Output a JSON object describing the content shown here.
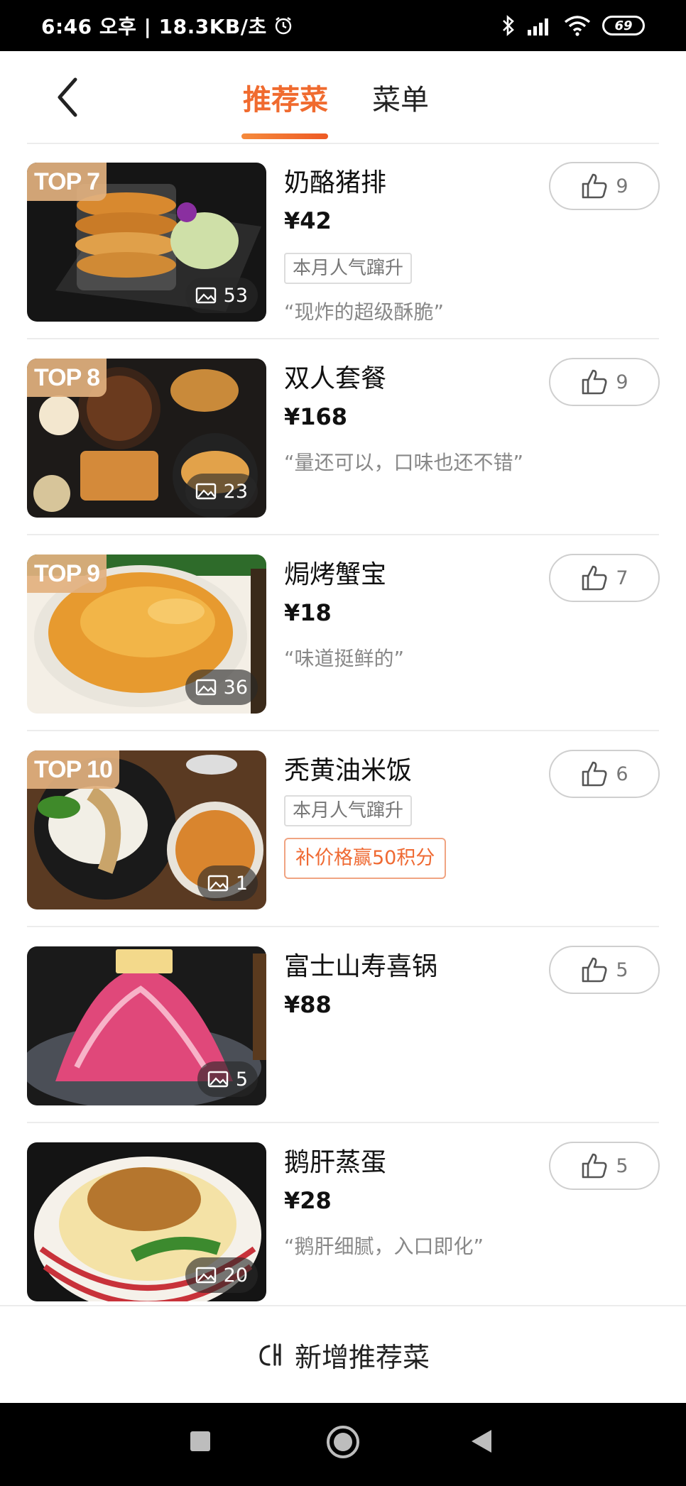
{
  "status_bar": {
    "time_info": "6:46 오후 | 18.3KB/초",
    "battery": "69"
  },
  "header": {
    "tabs": [
      {
        "label": "推荐菜",
        "active": true
      },
      {
        "label": "菜单",
        "active": false
      }
    ]
  },
  "dishes": [
    {
      "rank": "TOP 7",
      "name": "奶酪猪排",
      "price": "¥42",
      "tag": "本月人气蹿升",
      "promo": "",
      "quote": "“现炸的超级酥脆”",
      "photos": "53",
      "likes": "9"
    },
    {
      "rank": "TOP 8",
      "name": "双人套餐",
      "price": "¥168",
      "tag": "",
      "promo": "",
      "quote": "“量还可以，口味也还不错”",
      "photos": "23",
      "likes": "9"
    },
    {
      "rank": "TOP 9",
      "name": "焗烤蟹宝",
      "price": "¥18",
      "tag": "",
      "promo": "",
      "quote": "“味道挺鲜的”",
      "photos": "36",
      "likes": "7"
    },
    {
      "rank": "TOP 10",
      "name": "秃黄油米饭",
      "price": "",
      "tag": "本月人气蹿升",
      "promo": "补价格赢50积分",
      "quote": "",
      "photos": "1",
      "likes": "6"
    },
    {
      "rank": "",
      "name": "富士山寿喜锅",
      "price": "¥88",
      "tag": "",
      "promo": "",
      "quote": "",
      "photos": "5",
      "likes": "5"
    },
    {
      "rank": "",
      "name": "鹅肝蒸蛋",
      "price": "¥28",
      "tag": "",
      "promo": "",
      "quote": "“鹅肝细腻，入口即化”",
      "photos": "20",
      "likes": "5"
    }
  ],
  "footer": {
    "add_label": "新增推荐菜"
  },
  "colors": {
    "accent": "#f06b2f",
    "badge": "#e2b17f",
    "promo": "#ef6a33"
  }
}
